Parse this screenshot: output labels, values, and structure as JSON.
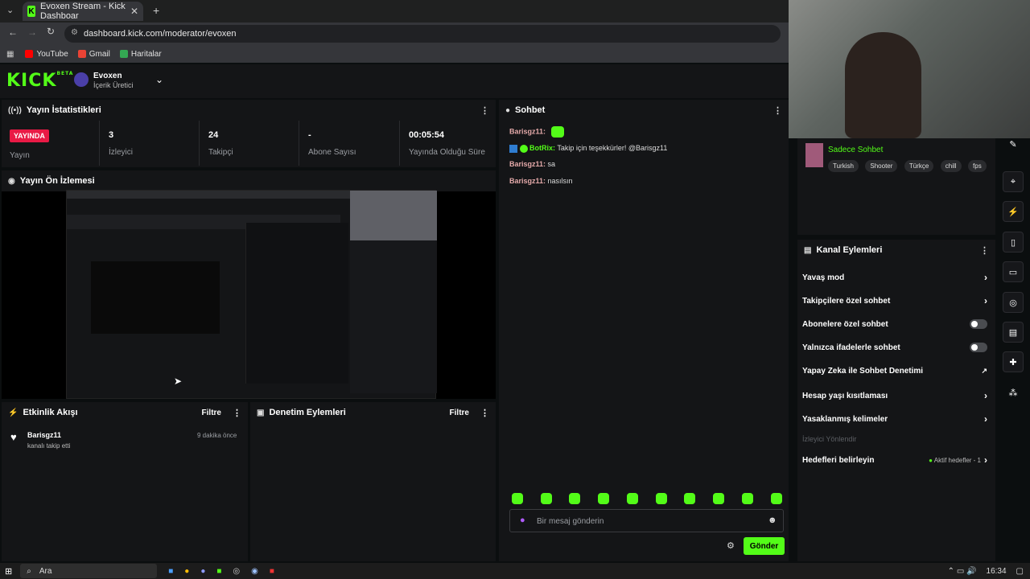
{
  "browser": {
    "tab_title": "Evoxen Stream - Kick Dashboar",
    "url": "dashboard.kick.com/moderator/evoxen",
    "bookmarks": [
      "YouTube",
      "Gmail",
      "Haritalar"
    ]
  },
  "header": {
    "logo": "KICK",
    "logo_tag": "BETA",
    "channel_name": "Evoxen",
    "channel_role": "İçerik Üretici"
  },
  "stats": {
    "title": "Yayın İstatistikleri",
    "live_badge": "YAYINDA",
    "live_label": "Yayın",
    "viewers_value": "3",
    "viewers_label": "İzleyici",
    "followers_value": "24",
    "followers_label": "Takipçi",
    "subs_value": "-",
    "subs_label": "Abone Sayısı",
    "uptime_value": "00:05:54",
    "uptime_label": "Yayında Olduğu Süre"
  },
  "preview": {
    "title": "Yayın Ön İzlemesi"
  },
  "activity": {
    "title": "Etkinlik Akışı",
    "filter": "Filtre",
    "event_user": "Barisgz11",
    "event_text": "kanalı takip etti",
    "event_time": "9 dakika önce"
  },
  "moderation": {
    "title": "Denetim Eylemleri",
    "filter": "Filtre"
  },
  "chat": {
    "title": "Sohbet",
    "messages": [
      {
        "user": "Barisgz11:",
        "text": ""
      },
      {
        "user": "BotRix:",
        "text": "Takip için teşekkürler! @Barisgz11"
      },
      {
        "user": "Barisgz11:",
        "text": "sa"
      },
      {
        "user": "Barisgz11:",
        "text": "nasılsın"
      }
    ],
    "input_placeholder": "Bir mesaj gönderin",
    "send_label": "Gönder"
  },
  "stream_info": {
    "title": "Sadece Sohbet",
    "tags": [
      "Turkish",
      "Shooter",
      "Türkçe",
      "chill",
      "fps"
    ]
  },
  "channel_actions": {
    "title": "Kanal Eylemleri",
    "items": [
      "Yavaş mod",
      "Takipçilere özel sohbet",
      "Abonelere özel sohbet",
      "Yalnızca ifadelerle sohbet",
      "Yapay Zeka ile Sohbet Denetimi",
      "Hesap yaşı kısıtlaması",
      "Yasaklanmış kelimeler"
    ],
    "section_label": "İzleyici Yönlendir",
    "goals_label": "Hedefleri belirleyin",
    "goals_status": "Aktif hedefler - 1"
  },
  "taskbar": {
    "search": "Ara",
    "clock": "16:34"
  },
  "colors": {
    "kick_green": "#53fc18",
    "live_red": "#e91a45",
    "panel": "#141517",
    "background": "#0b0e0f"
  }
}
